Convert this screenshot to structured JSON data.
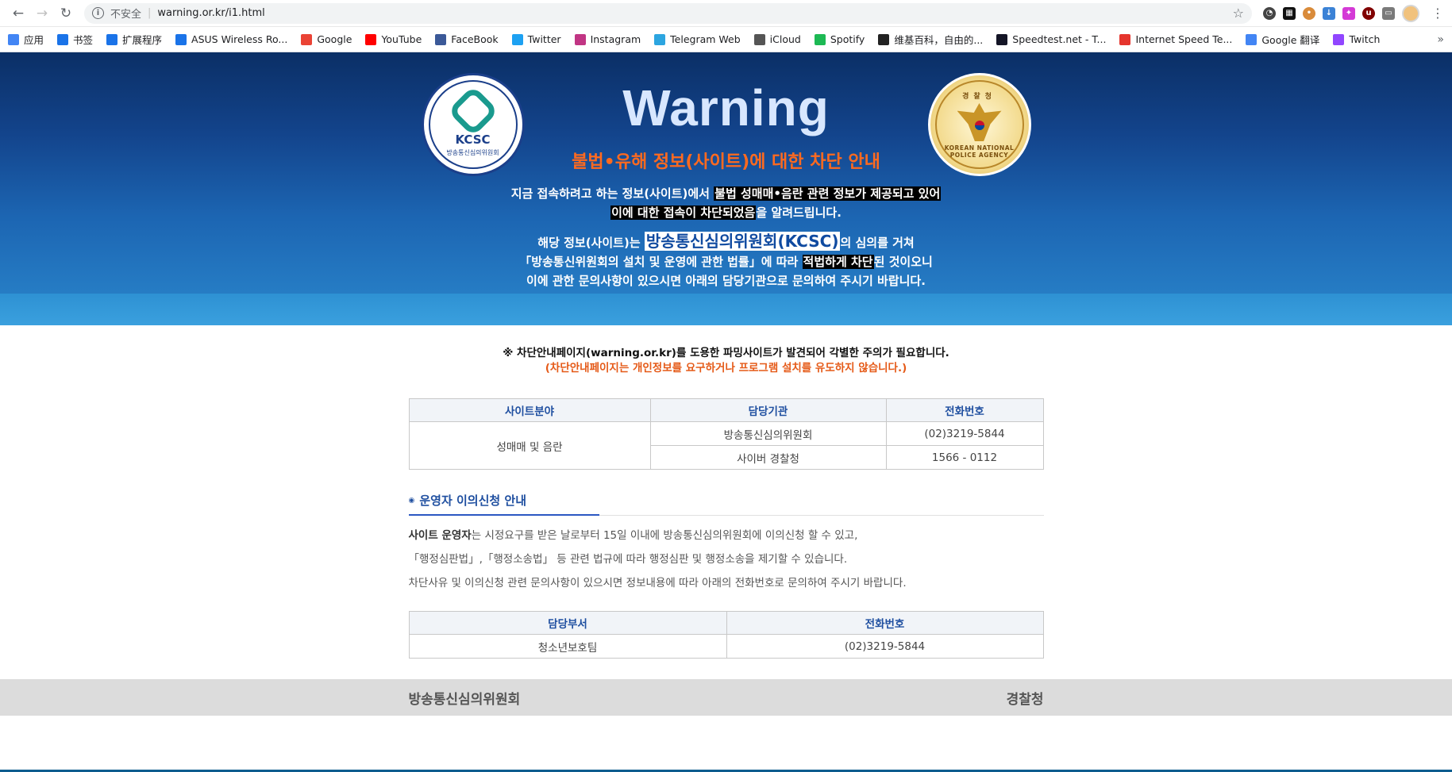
{
  "browser": {
    "url": "warning.or.kr/i1.html",
    "security_label": "不安全",
    "extensions": [
      "speedometer",
      "notion",
      "cookie",
      "download",
      "pinwheel",
      "ublock",
      "cast"
    ],
    "bookmarks": [
      {
        "label": "应用",
        "icon": "apps-grid-icon",
        "color": "#4285f4"
      },
      {
        "label": "书签",
        "icon": "star-icon",
        "color": "#1a73e8"
      },
      {
        "label": "扩展程序",
        "icon": "puzzle-icon",
        "color": "#1a73e8"
      },
      {
        "label": "ASUS Wireless Ro...",
        "icon": "wireless-icon",
        "color": "#1a73e8"
      },
      {
        "label": "Google",
        "icon": "google-icon",
        "color": "#ea4335"
      },
      {
        "label": "YouTube",
        "icon": "youtube-icon",
        "color": "#ff0000"
      },
      {
        "label": "FaceBook",
        "icon": "facebook-icon",
        "color": "#3b5998"
      },
      {
        "label": "Twitter",
        "icon": "twitter-icon",
        "color": "#1da1f2"
      },
      {
        "label": "Instagram",
        "icon": "instagram-icon",
        "color": "#c13584"
      },
      {
        "label": "Telegram Web",
        "icon": "telegram-icon",
        "color": "#2ca5e0"
      },
      {
        "label": "iCloud",
        "icon": "apple-icon",
        "color": "#555555"
      },
      {
        "label": "Spotify",
        "icon": "spotify-icon",
        "color": "#1db954"
      },
      {
        "label": "维基百科，自由的...",
        "icon": "wikipedia-icon",
        "color": "#222222"
      },
      {
        "label": "Speedtest.net - T...",
        "icon": "speedtest-icon",
        "color": "#141526"
      },
      {
        "label": "Internet Speed Te...",
        "icon": "fast-icon",
        "color": "#e5352d"
      },
      {
        "label": "Google 翻译",
        "icon": "translate-icon",
        "color": "#4285f4"
      },
      {
        "label": "Twitch",
        "icon": "twitch-icon",
        "color": "#9146ff"
      }
    ]
  },
  "hero": {
    "title": "Warning",
    "subtitle": "불법•유해 정보(사이트)에 대한 차단 안내",
    "line1_a": "지금 접속하려고 하는 정보(사이트)에서 ",
    "line1_hl": "불법 성매매•음란 관련 정보가 제공되고 있어",
    "line2_hl": "이에 대한 접속이 차단되었음",
    "line2_b": "을 알려드립니다.",
    "line3_a": "해당 정보(사이트)는 ",
    "line3_hl": "방송통신심의위원회(KCSC)",
    "line3_b": "의 심의를 거쳐",
    "line4_a": "「방송통신위원회의 설치 및 운영에 관한 법률」에 따라 ",
    "line4_hl": "적법하게 차단",
    "line4_b": "된 것이오니",
    "line5": "이에 관한 문의사항이 있으시면 아래의 담당기관으로 문의하여 주시기 바랍니다.",
    "left_seal": {
      "abbr": "KCSC",
      "name": "방송통신심의위원회"
    },
    "right_seal": {
      "top": "경찰청",
      "name": "KOREAN NATIONAL POLICE AGENCY"
    }
  },
  "caution": {
    "line1": "※ 차단안내페이지(warning.or.kr)를 도용한 파밍사이트가 발견되어 각별한 주의가 필요합니다.",
    "line2": "(차단안내페이지는 개인정보를 요구하거나 프로그램 설치를 유도하지 않습니다.)"
  },
  "table1": {
    "headers": [
      "사이트분야",
      "담당기관",
      "전화번호"
    ],
    "category": "성매매 및 음란",
    "rows": [
      {
        "agency": "방송통신심의위원회",
        "phone": "(02)3219-5844"
      },
      {
        "agency": "사이버 경찰청",
        "phone": "1566 - 0112"
      }
    ]
  },
  "appeal": {
    "heading": "운영자 이의신청 안내",
    "p1_bold": "사이트 운영자",
    "p1": "는 시정요구를 받은 날로부터 15일 이내에 방송통신심의위원회에 이의신청 할 수 있고,",
    "p2": "「행정심판법」,「행정소송법」 등 관련 법규에 따라 행정심판 및 행정소송을 제기할 수 있습니다.",
    "p3": "차단사유 및 이의신청 관련 문의사항이 있으시면 정보내용에 따라 아래의 전화번호로 문의하여 주시기 바랍니다."
  },
  "table2": {
    "headers": [
      "담당부서",
      "전화번호"
    ],
    "rows": [
      {
        "dept": "청소년보호팀",
        "phone": "(02)3219-5844"
      }
    ]
  },
  "footer": {
    "left": "방송통신심의위원회",
    "right": "경찰청"
  }
}
